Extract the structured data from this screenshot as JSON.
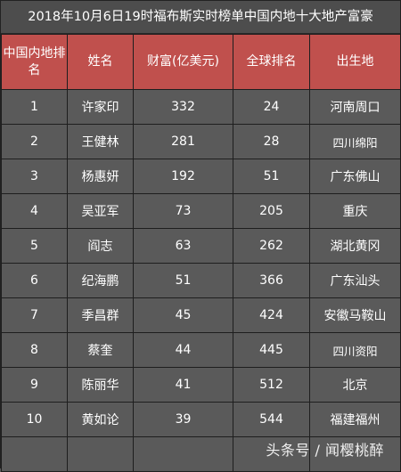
{
  "title": "2018年10月6日19时福布斯实时榜单中国内地十大地产富豪",
  "headers": [
    "中国内地排名",
    "姓名",
    "财富(亿美元)",
    "全球排名",
    "出生地"
  ],
  "rows": [
    {
      "rank": "1",
      "name": "许家印",
      "wealth": "332",
      "global": "24",
      "birthplace": "河南周口"
    },
    {
      "rank": "2",
      "name": "王健林",
      "wealth": "281",
      "global": "28",
      "birthplace": "四川绵阳"
    },
    {
      "rank": "3",
      "name": "杨惠妍",
      "wealth": "192",
      "global": "51",
      "birthplace": "广东佛山"
    },
    {
      "rank": "4",
      "name": "吴亚军",
      "wealth": "73",
      "global": "205",
      "birthplace": "重庆"
    },
    {
      "rank": "5",
      "name": "阎志",
      "wealth": "63",
      "global": "262",
      "birthplace": "湖北黄冈"
    },
    {
      "rank": "6",
      "name": "纪海鹏",
      "wealth": "51",
      "global": "366",
      "birthplace": "广东汕头"
    },
    {
      "rank": "7",
      "name": "季昌群",
      "wealth": "45",
      "global": "424",
      "birthplace": "安徽马鞍山"
    },
    {
      "rank": "8",
      "name": "蔡奎",
      "wealth": "44",
      "global": "445",
      "birthplace": "四川资阳"
    },
    {
      "rank": "9",
      "name": "陈丽华",
      "wealth": "41",
      "global": "512",
      "birthplace": "北京"
    },
    {
      "rank": "10",
      "name": "黄如论",
      "wealth": "39",
      "global": "544",
      "birthplace": "福建福州"
    }
  ],
  "watermark": "头条号 / 闻樱桃醉"
}
